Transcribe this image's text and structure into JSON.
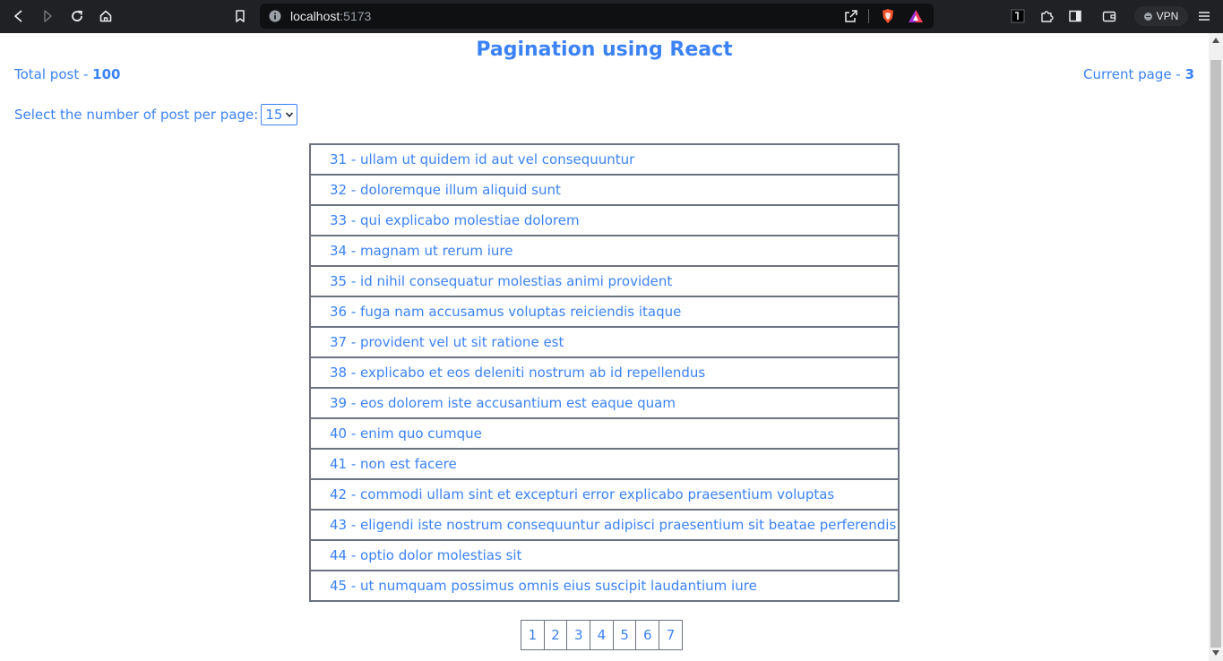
{
  "browser": {
    "url_host": "localhost",
    "url_port": ":5173",
    "vpn_label": "VPN"
  },
  "page": {
    "title": "Pagination using React",
    "total_post_label": "Total post - ",
    "total_post_value": "100",
    "current_page_label": "Current page - ",
    "current_page_value": "3",
    "per_page_label": "Select the number of post per page:",
    "per_page_selected": "15"
  },
  "posts": [
    "31 - ullam ut quidem id aut vel consequuntur",
    "32 - doloremque illum aliquid sunt",
    "33 - qui explicabo molestiae dolorem",
    "34 - magnam ut rerum iure",
    "35 - id nihil consequatur molestias animi provident",
    "36 - fuga nam accusamus voluptas reiciendis itaque",
    "37 - provident vel ut sit ratione est",
    "38 - explicabo et eos deleniti nostrum ab id repellendus",
    "39 - eos dolorem iste accusantium est eaque quam",
    "40 - enim quo cumque",
    "41 - non est facere",
    "42 - commodi ullam sint et excepturi error explicabo praesentium voluptas",
    "43 - eligendi iste nostrum consequuntur adipisci praesentium sit beatae perferendis",
    "44 - optio dolor molestias sit",
    "45 - ut numquam possimus omnis eius suscipit laudantium iure"
  ],
  "pagination": [
    "1",
    "2",
    "3",
    "4",
    "5",
    "6",
    "7"
  ],
  "colors": {
    "accent": "#3b82f6",
    "border": "#6b7280",
    "chrome_bg": "#202124"
  }
}
